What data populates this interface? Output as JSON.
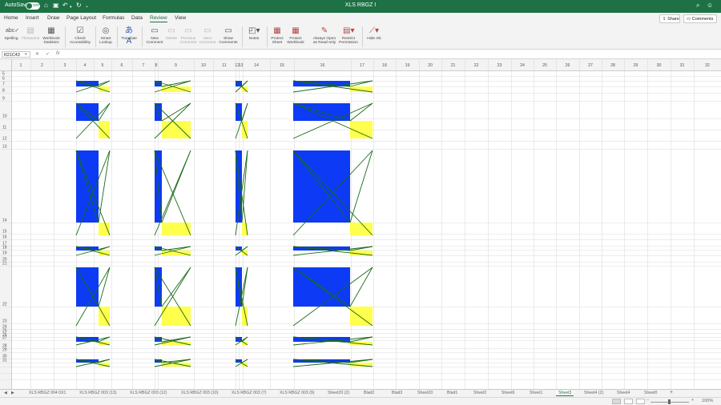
{
  "titlebar": {
    "autosave_label": "AutoSave",
    "autosave_state": "OFF",
    "title": "XLS RBGZ I",
    "icons": [
      "home-icon",
      "save-icon",
      "undo-icon",
      "redo-icon",
      "refresh-icon",
      "more-icon",
      "search-icon",
      "account-icon"
    ]
  },
  "ribbon_tabs": [
    "Home",
    "Insert",
    "Draw",
    "Page Layout",
    "Formulas",
    "Data",
    "Review",
    "View"
  ],
  "active_tab": "Review",
  "share_label": "Share",
  "comments_label": "Comments",
  "ribbon": {
    "spelling_label": [
      "Spelling"
    ],
    "thesaurus_label": [
      "Thesaurus"
    ],
    "workbook_statistics_label": [
      "Workbook",
      "Statistics"
    ],
    "check_accessibility_label": [
      "Check",
      "Accessibility"
    ],
    "smart_lookup_label": [
      "Smart",
      "Lookup"
    ],
    "translate_label": [
      "Translate"
    ],
    "new_comment_label": [
      "New",
      "Comment"
    ],
    "delete_label": [
      "Delete"
    ],
    "previous_comment_label": [
      "Previous",
      "Comment"
    ],
    "next_comment_label": [
      "Next",
      "Comment"
    ],
    "show_comments_label": [
      "Show",
      "Comments"
    ],
    "notes_label": [
      "Notes"
    ],
    "protect_sheet_label": [
      "Protect",
      "Sheet"
    ],
    "protect_workbook_label": [
      "Protect",
      "Workbook"
    ],
    "always_open_readonly_label": [
      "Always Open",
      "as Read-only"
    ],
    "restrict_permission_label": [
      "Restrict",
      "Permission"
    ],
    "hide_ink_label": [
      "Hide Ink"
    ]
  },
  "formula_bar": {
    "name_box": "R21C43",
    "cancel": "✕",
    "enter": "✓",
    "fx": "fx",
    "formula": ""
  },
  "grid": {
    "column_headers": [
      "1",
      "2",
      "3",
      "4",
      "5",
      "6",
      "7",
      "8",
      "9",
      "10",
      "11",
      "12",
      "13",
      "14",
      "15",
      "16",
      "17",
      "18",
      "19",
      "20",
      "21",
      "22",
      "23",
      "24",
      "25",
      "26",
      "27",
      "28",
      "29",
      "30",
      "31",
      "32"
    ],
    "row_headers": [
      "5",
      "6",
      "7",
      "8",
      "9",
      "10",
      "11",
      "12",
      "13",
      "14",
      "15",
      "16",
      "17",
      "18",
      "19",
      "20",
      "21",
      "22",
      "23",
      "24",
      "25",
      "26",
      "27",
      "28",
      "29",
      "30",
      "31"
    ]
  },
  "sheet_tabs": [
    "XLS RBGZ 004 0X1",
    "XLS RBGZ 003 (13)",
    "XLS RBGZ 003 (12)",
    "XLS RBGZ 003 (10)",
    "XLS RBGZ 003 (7)",
    "XLS RBGZ 003 (9)",
    "Sheet20 (2)",
    "Blad2",
    "Blad3",
    "Sheet20",
    "Blad1",
    "Sheet2",
    "Sheet6",
    "Sheet1",
    "Sheet3",
    "Sheet4 (2)",
    "Sheet4",
    "Sheet0"
  ],
  "active_sheet": "Sheet3",
  "add_sheet_label": "+",
  "status": {
    "zoom": "100%"
  },
  "colors": {
    "accent": "#1e7145",
    "shape_blue": "#0c3af5",
    "shape_yellow": "#ffff4d",
    "line_green": "#1a6a1a"
  }
}
